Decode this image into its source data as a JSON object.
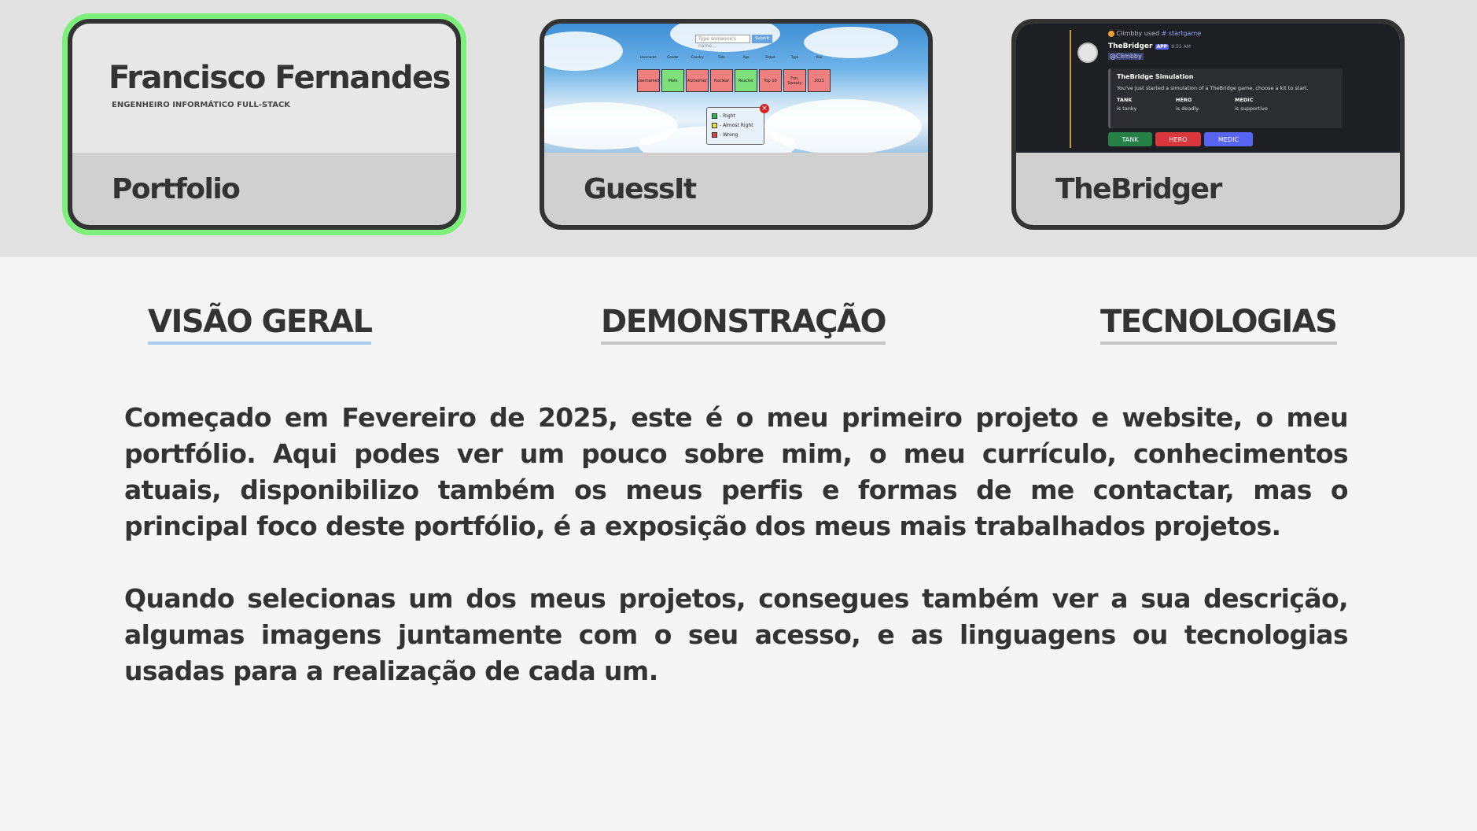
{
  "projects": [
    {
      "label": "Portfolio",
      "selected": true,
      "thumbnail": {
        "name": "Francisco Fernandes",
        "role": "ENGENHEIRO INFORMÁTICO FULL-STACK"
      }
    },
    {
      "label": "GuessIt",
      "selected": false,
      "thumbnail": {
        "input_placeholder": "Type someone's name...",
        "submit_label": "Submit",
        "headers": [
          "Username",
          "Gender",
          "Country",
          "Side",
          "Age",
          "Debut",
          "Type",
          "Year"
        ],
        "cells": [
          {
            "text": "Username3",
            "status": "wrong"
          },
          {
            "text": "Male",
            "status": "right"
          },
          {
            "text": "Alzheimer",
            "status": "wrong"
          },
          {
            "text": "Nuclear",
            "status": "wrong"
          },
          {
            "text": "Reacter",
            "status": "right"
          },
          {
            "text": "Top 10",
            "status": "wrong"
          },
          {
            "text": "Fun, Sweaty",
            "status": "wrong"
          },
          {
            "text": "2021",
            "status": "wrong"
          }
        ],
        "legend": [
          {
            "text": "- Right",
            "color": "#2fb84a"
          },
          {
            "text": "- Almost Right",
            "color": "#f2e03a"
          },
          {
            "text": "- Wrong",
            "color": "#e0403a"
          }
        ],
        "colors": {
          "right": "#7ee07a",
          "wrong": "#f07f7f"
        }
      }
    },
    {
      "label": "TheBridger",
      "selected": false,
      "thumbnail": {
        "command_user": "Climbby used",
        "command": "startgame",
        "bot_name": "TheBridger",
        "app_badge": "APP",
        "time": "9:55 AM",
        "mention": "@Climbby",
        "embed_title": "TheBridge Simulation",
        "embed_desc": "You've just started a simulation of a TheBridge game, choose a kit to start.",
        "kits": [
          {
            "name": "TANK",
            "desc": "is tanky"
          },
          {
            "name": "HERO",
            "desc": "is deadly."
          },
          {
            "name": "MEDIC",
            "desc": "is supportive"
          }
        ],
        "buttons": [
          {
            "label": "TANK",
            "color": "#248046"
          },
          {
            "label": "HERO",
            "color": "#da373c"
          },
          {
            "label": "MEDIC",
            "color": "#5865f2"
          }
        ]
      }
    }
  ],
  "tabs": [
    {
      "label": "VISÃO GERAL",
      "active": true
    },
    {
      "label": "DEMONSTRAÇÃO",
      "active": false
    },
    {
      "label": "TECNOLOGIAS",
      "active": false
    }
  ],
  "overview": {
    "paragraph1": "Começado em Fevereiro de 2025, este é o meu primeiro projeto e website, o meu portfólio. Aqui podes ver um pouco sobre mim, o meu currículo, conhecimentos atuais, disponibilizo também os meus perfis e formas de me contactar, mas o principal foco deste portfólio, é a exposição dos meus mais trabalhados projetos.",
    "paragraph2": "Quando selecionas um dos meus projetos, consegues também ver a sua descrição, algumas imagens juntamente com o seu acesso, e as linguagens ou tecnologias usadas para a realização de cada um."
  }
}
